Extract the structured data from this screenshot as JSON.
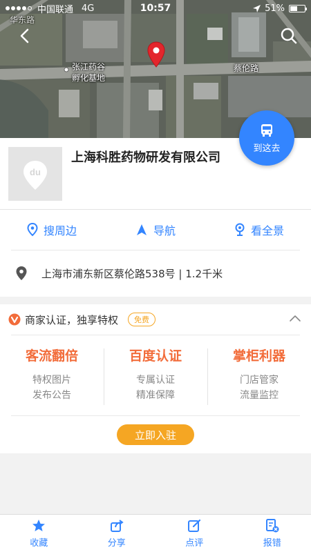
{
  "status_bar": {
    "carrier": "中国联通",
    "network": "4G",
    "time": "10:57",
    "battery_percent": "51%",
    "battery_level": 0.51
  },
  "map": {
    "labels": [
      "张江药谷",
      "孵化基地",
      "蔡伦路",
      "华东路"
    ],
    "pin_color": "#e3262c"
  },
  "place": {
    "name": "上海科胜药物研发有限公司",
    "thumb_logo": "du",
    "go_label": "到这去",
    "actions": [
      {
        "icon": "location-pin-icon",
        "label": "搜周边"
      },
      {
        "icon": "navigation-arrow-icon",
        "label": "导航"
      },
      {
        "icon": "panorama-pin-icon",
        "label": "看全景"
      }
    ],
    "address": "上海市浦东新区蔡伦路538号 | 1.2千米"
  },
  "merchant": {
    "title": "商家认证，独享特权",
    "badge": "免费",
    "perks": [
      {
        "title": "客流翻倍",
        "lines": [
          "特权图片",
          "发布公告"
        ]
      },
      {
        "title": "百度认证",
        "lines": [
          "专属认证",
          "精准保障"
        ]
      },
      {
        "title": "掌柜利器",
        "lines": [
          "门店管家",
          "流量监控"
        ]
      }
    ],
    "join_label": "立即入驻"
  },
  "tabbar": [
    {
      "icon": "star-icon",
      "label": "收藏"
    },
    {
      "icon": "share-icon",
      "label": "分享"
    },
    {
      "icon": "edit-icon",
      "label": "点评"
    },
    {
      "icon": "report-icon",
      "label": "报错"
    }
  ],
  "colors": {
    "accent_blue": "#3385ff",
    "accent_orange": "#f26c3a",
    "badge_orange": "#f5a623"
  }
}
